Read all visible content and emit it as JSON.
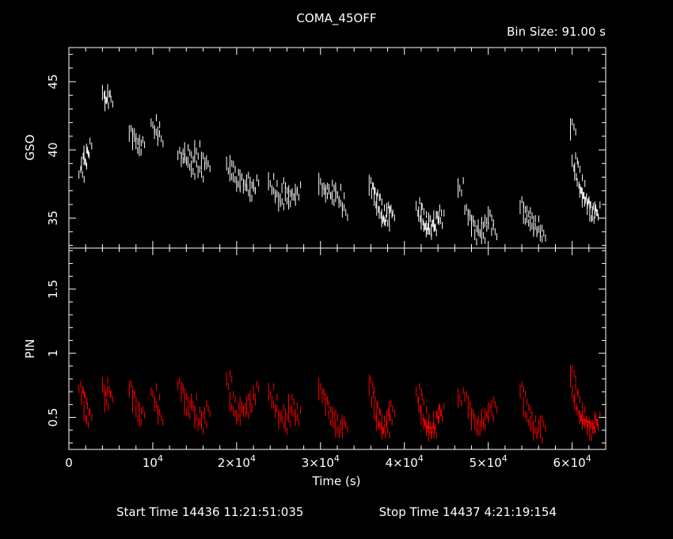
{
  "title": "COMA_45OFF",
  "bin_size": "Bin Size: 91.00 s",
  "footer": {
    "start": "Start Time 14436 11:21:51:035",
    "stop": "Stop Time 14437  4:21:19:154"
  },
  "colors": {
    "background": "#000000",
    "gso": "#ffffff",
    "pin": "#ff0000",
    "axes": "#ffffff"
  },
  "chart_data": [
    {
      "type": "line",
      "panel": "top",
      "ylabel": "GSO",
      "xlim": [
        0,
        64000
      ],
      "ylim": [
        32.8,
        47.5
      ],
      "yticks": [
        35,
        40,
        45
      ],
      "ytick_labels": [
        "35",
        "40",
        "45"
      ],
      "series": [
        {
          "x": [
            1200,
            1500,
            1800,
            2100,
            4000,
            4300,
            4600,
            7200,
            7600,
            8000,
            8400,
            9800,
            10200,
            10600,
            13000,
            13400,
            13800,
            14200,
            14600,
            15000,
            15400,
            15800,
            16200,
            18800,
            19200,
            19600,
            20000,
            20400,
            20800,
            21200,
            21600,
            22000,
            23800,
            24200,
            24600,
            25000,
            25400,
            25800,
            26200,
            26600,
            27000,
            29800,
            30200,
            30600,
            31000,
            31400,
            31800,
            32200,
            32600,
            35800,
            36100,
            36400,
            36700,
            37000,
            37300,
            37600,
            37900,
            38200,
            41400,
            41700,
            42000,
            42300,
            42600,
            42900,
            43200,
            43500,
            43800,
            44100,
            46400,
            47200,
            47600,
            48000,
            48400,
            48800,
            49200,
            49600,
            50000,
            50400,
            53800,
            54200,
            54600,
            55000,
            55400,
            55800,
            56200,
            59800,
            60000,
            60300,
            60600,
            60900,
            61200,
            61500,
            61800,
            62100,
            62400,
            62700
          ],
          "y": [
            38.2,
            39.0,
            39.6,
            40.1,
            44.2,
            43.6,
            43.9,
            41.2,
            40.8,
            40.5,
            40.2,
            42.0,
            41.3,
            41.0,
            39.6,
            39.3,
            39.8,
            39.1,
            38.6,
            39.9,
            38.4,
            39.2,
            38.8,
            39.0,
            38.4,
            38.0,
            37.5,
            37.8,
            37.2,
            37.6,
            37.0,
            37.4,
            37.7,
            37.0,
            36.6,
            36.2,
            37.2,
            36.8,
            36.4,
            36.7,
            36.9,
            37.5,
            37.0,
            36.8,
            37.2,
            36.5,
            36.9,
            36.1,
            35.6,
            37.4,
            36.8,
            36.5,
            36.0,
            35.4,
            35.0,
            34.8,
            35.6,
            35.2,
            35.9,
            35.3,
            34.9,
            34.4,
            34.2,
            34.6,
            34.1,
            34.9,
            35.2,
            35.0,
            37.2,
            35.6,
            35.0,
            34.4,
            33.8,
            34.3,
            33.9,
            34.8,
            35.2,
            34.0,
            35.8,
            35.3,
            35.0,
            34.6,
            34.4,
            34.0,
            33.9,
            41.5,
            39.2,
            38.4,
            37.6,
            37.0,
            36.5,
            36.2,
            35.8,
            35.5,
            35.2,
            35.6
          ]
        }
      ]
    },
    {
      "type": "line",
      "panel": "bottom",
      "ylabel": "PIN",
      "xlabel": "Time (s)",
      "xlim": [
        0,
        64000
      ],
      "ylim": [
        0.25,
        1.82
      ],
      "yticks": [
        0.5,
        1,
        1.5
      ],
      "ytick_labels": [
        "0.5",
        "1",
        "1.5"
      ],
      "xticks": [
        0,
        10000,
        20000,
        30000,
        40000,
        50000,
        60000
      ],
      "xtick_labels": [
        {
          "base": "0",
          "exp": ""
        },
        {
          "base": "10",
          "exp": "4"
        },
        {
          "base": "2×10",
          "exp": "4"
        },
        {
          "base": "3×10",
          "exp": "4"
        },
        {
          "base": "4×10",
          "exp": "4"
        },
        {
          "base": "5×10",
          "exp": "4"
        },
        {
          "base": "6×10",
          "exp": "4"
        }
      ],
      "series": [
        {
          "x": [
            1200,
            1500,
            1800,
            2100,
            4000,
            4300,
            4600,
            7200,
            7600,
            8000,
            8400,
            9800,
            10200,
            10600,
            13000,
            13400,
            13800,
            14200,
            14600,
            15000,
            15400,
            15800,
            16200,
            18800,
            19200,
            19600,
            20000,
            20400,
            20800,
            21200,
            21600,
            22000,
            23800,
            24200,
            24600,
            25000,
            25400,
            25800,
            26200,
            26600,
            27000,
            29800,
            30200,
            30600,
            31000,
            31400,
            31800,
            32200,
            32600,
            35800,
            36100,
            36400,
            36700,
            37000,
            37300,
            37600,
            37900,
            38200,
            41400,
            41700,
            42000,
            42300,
            42600,
            42900,
            43200,
            43500,
            43800,
            44100,
            46400,
            47200,
            47600,
            48000,
            48400,
            48800,
            49200,
            49600,
            50000,
            50400,
            53800,
            54200,
            54600,
            55000,
            55400,
            55800,
            56200,
            59800,
            60000,
            60300,
            60600,
            60900,
            61200,
            61500,
            61800,
            62100,
            62400,
            62700
          ],
          "y": [
            0.72,
            0.65,
            0.55,
            0.48,
            0.75,
            0.62,
            0.7,
            0.72,
            0.62,
            0.55,
            0.5,
            0.7,
            0.6,
            0.52,
            0.75,
            0.68,
            0.6,
            0.55,
            0.62,
            0.5,
            0.45,
            0.48,
            0.55,
            0.8,
            0.62,
            0.55,
            0.5,
            0.58,
            0.55,
            0.6,
            0.62,
            0.7,
            0.7,
            0.6,
            0.55,
            0.48,
            0.52,
            0.45,
            0.6,
            0.55,
            0.5,
            0.72,
            0.66,
            0.58,
            0.52,
            0.48,
            0.42,
            0.4,
            0.46,
            0.75,
            0.62,
            0.55,
            0.48,
            0.45,
            0.4,
            0.42,
            0.5,
            0.55,
            0.7,
            0.6,
            0.52,
            0.45,
            0.42,
            0.4,
            0.38,
            0.48,
            0.52,
            0.55,
            0.65,
            0.66,
            0.55,
            0.48,
            0.45,
            0.42,
            0.48,
            0.52,
            0.55,
            0.6,
            0.7,
            0.58,
            0.5,
            0.45,
            0.4,
            0.38,
            0.45,
            0.82,
            0.7,
            0.62,
            0.55,
            0.5,
            0.48,
            0.45,
            0.42,
            0.4,
            0.44,
            0.48
          ]
        }
      ]
    }
  ]
}
